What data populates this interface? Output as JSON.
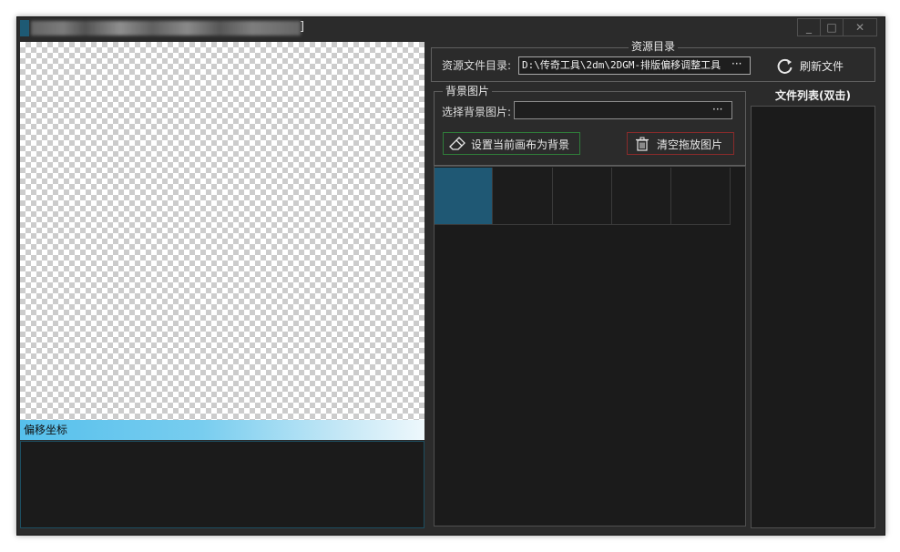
{
  "window": {
    "title_tail": "]",
    "controls": {
      "minimize": "_",
      "maximize": "□",
      "close": "✕"
    }
  },
  "canvas": {
    "offset_label": "偏移坐标"
  },
  "resource_dir": {
    "group_title": "资源目录",
    "label": "资源文件目录:",
    "path": "D:\\传奇工具\\2dm\\2DGM-排版偏移调整工具",
    "browse_dots": "···",
    "refresh_label": "刷新文件",
    "refresh_icon": "refresh-icon"
  },
  "background": {
    "group_title": "背景图片",
    "label": "选择背景图片:",
    "input_value": "",
    "browse_dots": "···",
    "set_bg_label": "设置当前画布为背景",
    "set_bg_icon": "eraser-icon",
    "set_bg_border_color": "#2f7d3a",
    "clear_label": "清空拖放图片",
    "clear_icon": "trash-icon",
    "clear_border_color": "#8a2b2b"
  },
  "thumbnails": {
    "selected_index": 0,
    "selected_color": "#1f5874",
    "count": 5
  },
  "file_list": {
    "header": "文件列表(双击)",
    "items": []
  }
}
